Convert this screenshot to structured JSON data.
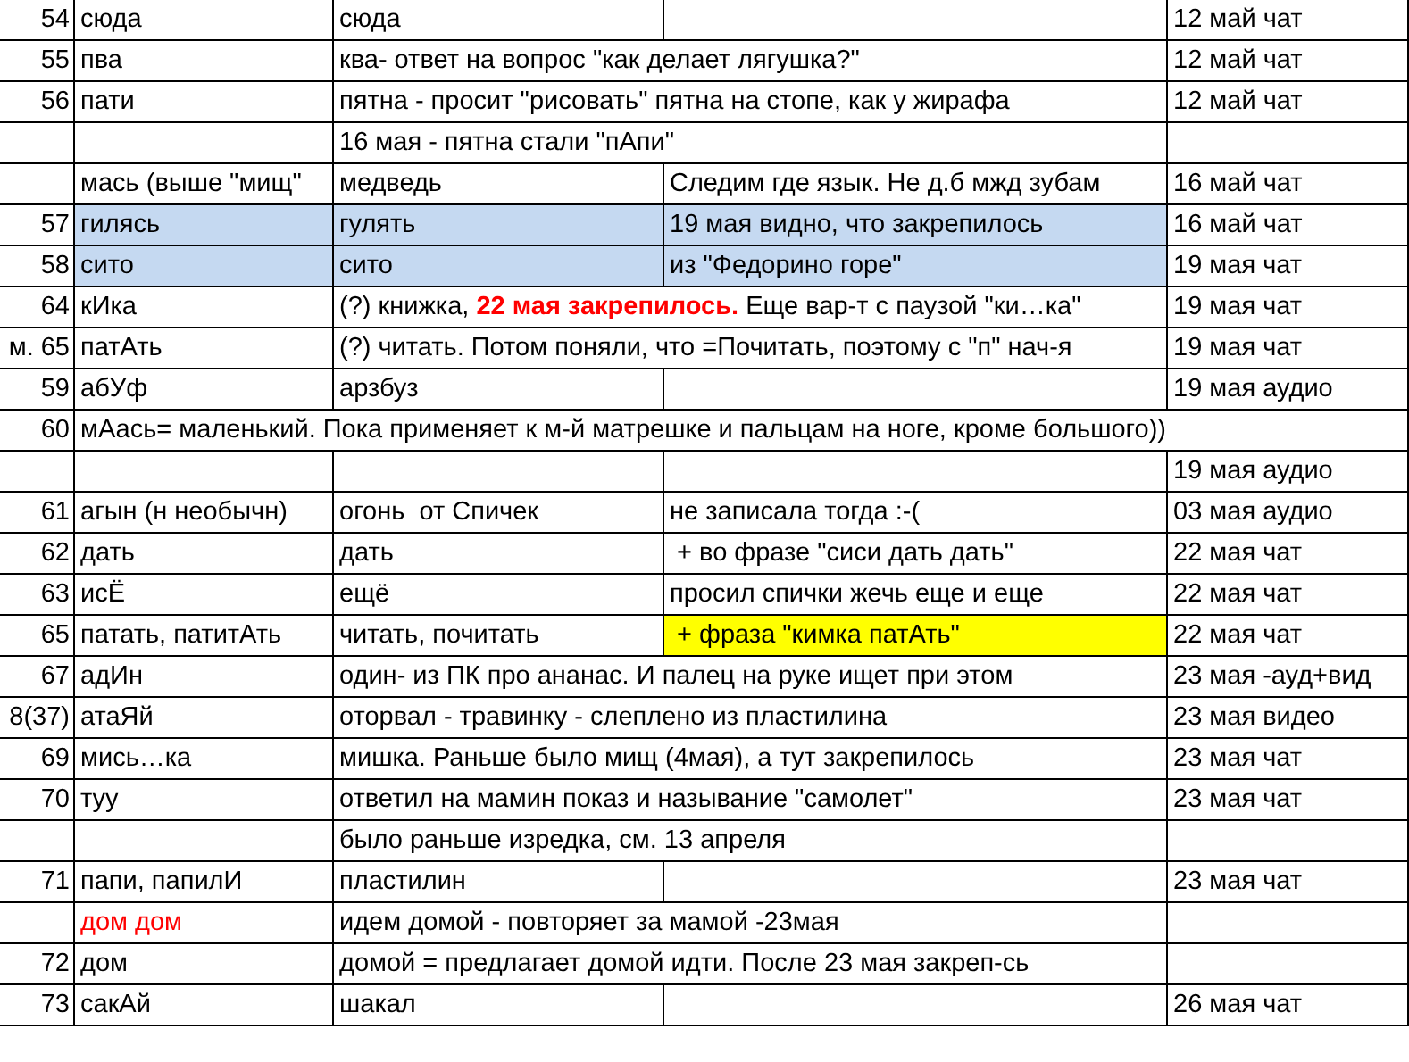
{
  "sheet": {
    "rows": [
      {
        "cells": [
          {
            "text": "54"
          },
          {
            "text": "сюда"
          },
          {
            "text": "сюда"
          },
          {},
          {
            "text": "12 май чат"
          }
        ]
      },
      {
        "cells": [
          {
            "text": "55"
          },
          {
            "text": "пва"
          },
          {
            "text": "ква- ответ на вопрос \"как делает лягушка?\"",
            "kind": "merged"
          },
          {
            "text": "12 май чат"
          }
        ]
      },
      {
        "cells": [
          {
            "text": "56"
          },
          {
            "text": "пати"
          },
          {
            "text": "пятна - просит \"рисовать\" пятна на стопе, как у жирафа",
            "kind": "merged"
          },
          {
            "text": "12 май чат"
          }
        ]
      },
      {
        "cells": [
          {},
          {},
          {
            "text": "16 мая - пятна стали \"пАпи\"",
            "kind": "merged"
          },
          {}
        ]
      },
      {
        "cells": [
          {},
          {
            "text": "мась (выше \"мищ\""
          },
          {
            "text": "медведь"
          },
          {
            "text": "Следим где язык. Не д.б мжд зубам"
          },
          {
            "text": "16 май чат"
          }
        ]
      },
      {
        "cells": [
          {
            "text": "57"
          },
          {
            "text": "гилясь",
            "color": "#c5d9f1"
          },
          {
            "text": "гулять",
            "color": "#c5d9f1"
          },
          {
            "text": "19 мая видно, что закрепилось",
            "color": "#c5d9f1"
          },
          {
            "text": "16 май чат"
          }
        ]
      },
      {
        "cells": [
          {
            "text": "58"
          },
          {
            "text": "сито",
            "color": "#c5d9f1"
          },
          {
            "text": "сито",
            "color": "#c5d9f1"
          },
          {
            "text": "из \"Федорино горе\"",
            "color": "#c5d9f1"
          },
          {
            "text": "19 мая чат"
          }
        ]
      },
      {
        "cells": [
          {
            "text": "64"
          },
          {
            "text": "кИка"
          },
          {
            "text": "(?) книжка, **22 мая закрепилось.** Еще вар-т с паузой \"ки…ка\"",
            "kind": "merged"
          },
          {
            "text": "19 мая чат"
          }
        ]
      },
      {
        "cells": [
          {
            "text": "м. 65"
          },
          {
            "text": "патАть"
          },
          {
            "text": "(?) читать. Потом поняли, что =Почитать, поэтому с \"п\" нач-я",
            "kind": "merged"
          },
          {
            "text": "19 мая чат"
          }
        ]
      },
      {
        "cells": [
          {
            "text": "59"
          },
          {
            "text": "абУф"
          },
          {
            "text": "арзбуз"
          },
          {},
          {
            "text": "19 мая аудио"
          }
        ]
      },
      {
        "cells": [
          {
            "text": "60"
          },
          {
            "text": "мАась= маленький. Пока применяет к м-й матрешке и пальцам на ноге, кроме большого))",
            "kind": "overflow"
          }
        ]
      },
      {
        "cells": [
          {},
          {},
          {},
          {},
          {
            "text": "19 мая аудио"
          }
        ]
      },
      {
        "cells": [
          {
            "text": "61"
          },
          {
            "text": "агын (н необычн)"
          },
          {
            "text": "огонь  от Спичек"
          },
          {
            "text": "не записала тогда :-("
          },
          {
            "text": "03 мая аудио"
          }
        ]
      },
      {
        "cells": [
          {
            "text": "62"
          },
          {
            "text": "дать"
          },
          {
            "text": "дать"
          },
          {
            "text": " + во фразе \"сиси дать дать\""
          },
          {
            "text": "22 мая чат"
          }
        ]
      },
      {
        "cells": [
          {
            "text": "63"
          },
          {
            "text": "исЁ"
          },
          {
            "text": "ещё"
          },
          {
            "text": "просил спички жечь еще и еще"
          },
          {
            "text": "22 мая чат"
          }
        ]
      },
      {
        "cells": [
          {
            "text": "65"
          },
          {
            "text": "патать, патитАть"
          },
          {
            "text": "читать, почитать"
          },
          {
            "text": " + фраза \"кимка патАть\"",
            "color": "#ffff00"
          },
          {
            "text": "22 мая чат"
          }
        ]
      },
      {
        "cells": [
          {
            "text": "67"
          },
          {
            "text": "адИн"
          },
          {
            "text": "один- из ПК про ананас. И палец на руке ищет при этом",
            "kind": "merged"
          },
          {
            "text": "23 мая -ауд+вид"
          }
        ]
      },
      {
        "cells": [
          {
            "text": "8(37)"
          },
          {
            "text": "атаЯй"
          },
          {
            "text": "оторвал - травинку - слеплено из пластилина",
            "kind": "merged"
          },
          {
            "text": "23 мая видео"
          }
        ]
      },
      {
        "cells": [
          {
            "text": "69"
          },
          {
            "text": "мись…ка"
          },
          {
            "text": "мишка. Раньше было мищ (4мая), а тут закрепилось",
            "kind": "merged"
          },
          {
            "text": "23 мая чат"
          }
        ]
      },
      {
        "cells": [
          {
            "text": "70"
          },
          {
            "text": "туу"
          },
          {
            "text": "ответил на мамин показ и называние \"самолет\"",
            "kind": "merged"
          },
          {
            "text": "23 мая чат"
          }
        ]
      },
      {
        "cells": [
          {},
          {},
          {
            "text": "было раньше изредка, см. 13 апреля",
            "kind": "merged"
          },
          {}
        ]
      },
      {
        "cells": [
          {
            "text": "71"
          },
          {
            "text": "папи, папилИ"
          },
          {
            "text": "пластилин"
          },
          {},
          {
            "text": "23 мая чат"
          }
        ]
      },
      {
        "cells": [
          {},
          {
            "text": "дом дом",
            "red_text": true
          },
          {
            "text": "идем домой - повторяет за мамой -23мая",
            "kind": "merged"
          },
          {}
        ]
      },
      {
        "cells": [
          {
            "text": "72"
          },
          {
            "text": "дом"
          },
          {
            "text": "домой = предлагает домой идти. После 23 мая закреп-сь",
            "kind": "merged"
          },
          {}
        ]
      },
      {
        "cells": [
          {
            "text": "73"
          },
          {
            "text": "сакАй"
          },
          {
            "text": "шакал"
          },
          {},
          {
            "text": "26 мая чат"
          }
        ]
      }
    ]
  }
}
